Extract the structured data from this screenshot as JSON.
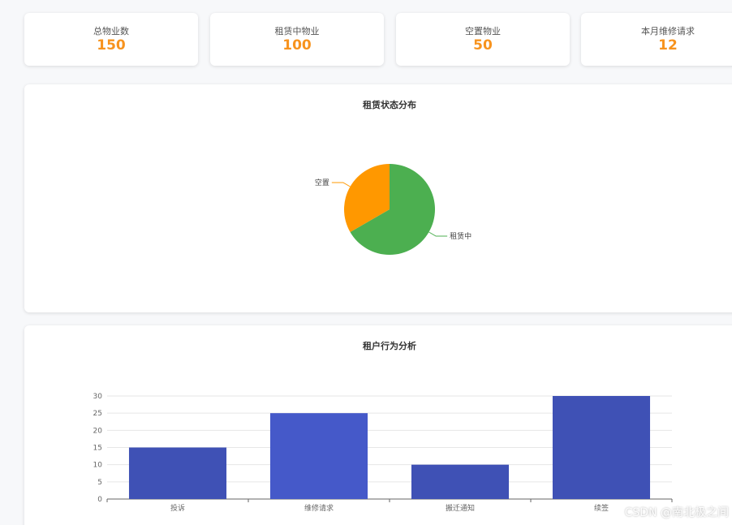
{
  "stats": [
    {
      "label": "总物业数",
      "value": "150"
    },
    {
      "label": "租赁中物业",
      "value": "100"
    },
    {
      "label": "空置物业",
      "value": "50"
    },
    {
      "label": "本月维修请求",
      "value": "12"
    }
  ],
  "pie_panel": {
    "title": "租赁状态分布"
  },
  "bar_panel": {
    "title": "租户行为分析"
  },
  "chart_data": [
    {
      "type": "pie",
      "title": "租赁状态分布",
      "categories": [
        "租赁中",
        "空置"
      ],
      "values": [
        100,
        50
      ],
      "colors": [
        "#4caf50",
        "#ff9800"
      ]
    },
    {
      "type": "bar",
      "title": "租户行为分析",
      "categories": [
        "投诉",
        "维修请求",
        "搬迁通知",
        "续签"
      ],
      "values": [
        15,
        25,
        10,
        30
      ],
      "ylim": [
        0,
        30
      ],
      "yticks": [
        0,
        5,
        10,
        15,
        20,
        25,
        30
      ],
      "grid": true,
      "colors": [
        "#3f51b5",
        "#4559c9",
        "#3f51b5",
        "#3f51b5"
      ]
    }
  ],
  "watermark": "CSDN @南北极之间"
}
